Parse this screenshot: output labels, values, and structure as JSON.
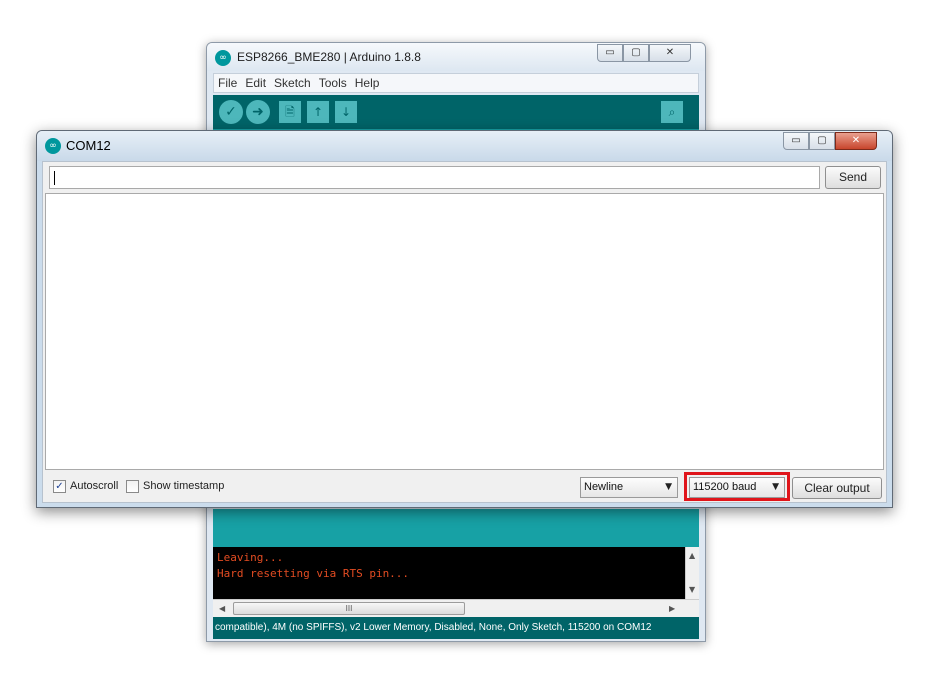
{
  "ide_window": {
    "title": "ESP8266_BME280 | Arduino 1.8.8",
    "icon": "arduino-logo-icon",
    "controls": {
      "minimize": "▭",
      "maximize": "▢",
      "close": "✕"
    },
    "menu": [
      "File",
      "Edit",
      "Sketch",
      "Tools",
      "Help"
    ],
    "toolbar": {
      "verify": "✓",
      "upload": "➜",
      "new": "🗎",
      "open": "↑",
      "save": "↓",
      "serial_monitor": "⌕"
    },
    "console_lines": [
      "Leaving...",
      "Hard resetting via RTS pin..."
    ],
    "scroll": {
      "up": "▲",
      "down": "▼",
      "left": "◀",
      "right": "▶",
      "grip": "III"
    },
    "status_bar": "compatible), 4M (no SPIFFS), v2 Lower Memory, Disabled, None, Only Sketch, 115200 on COM12",
    "colors": {
      "toolbar": "#006468",
      "accent": "#17a1a5",
      "console_text": "#e34c22"
    }
  },
  "serial_monitor": {
    "title": "COM12",
    "icon": "arduino-logo-icon",
    "controls": {
      "minimize": "▭",
      "maximize": "▢",
      "close": "✕"
    },
    "input": {
      "value": ""
    },
    "send_label": "Send",
    "output_text": "",
    "autoscroll": {
      "label": "Autoscroll",
      "checked": true,
      "mark": "✓"
    },
    "show_timestamp": {
      "label": "Show timestamp",
      "checked": false
    },
    "line_ending": {
      "selected": "Newline",
      "arrow": "▼"
    },
    "baud_rate": {
      "selected": "115200 baud",
      "arrow": "▼",
      "highlight_color": "#e0151b"
    },
    "clear_output_label": "Clear output"
  }
}
